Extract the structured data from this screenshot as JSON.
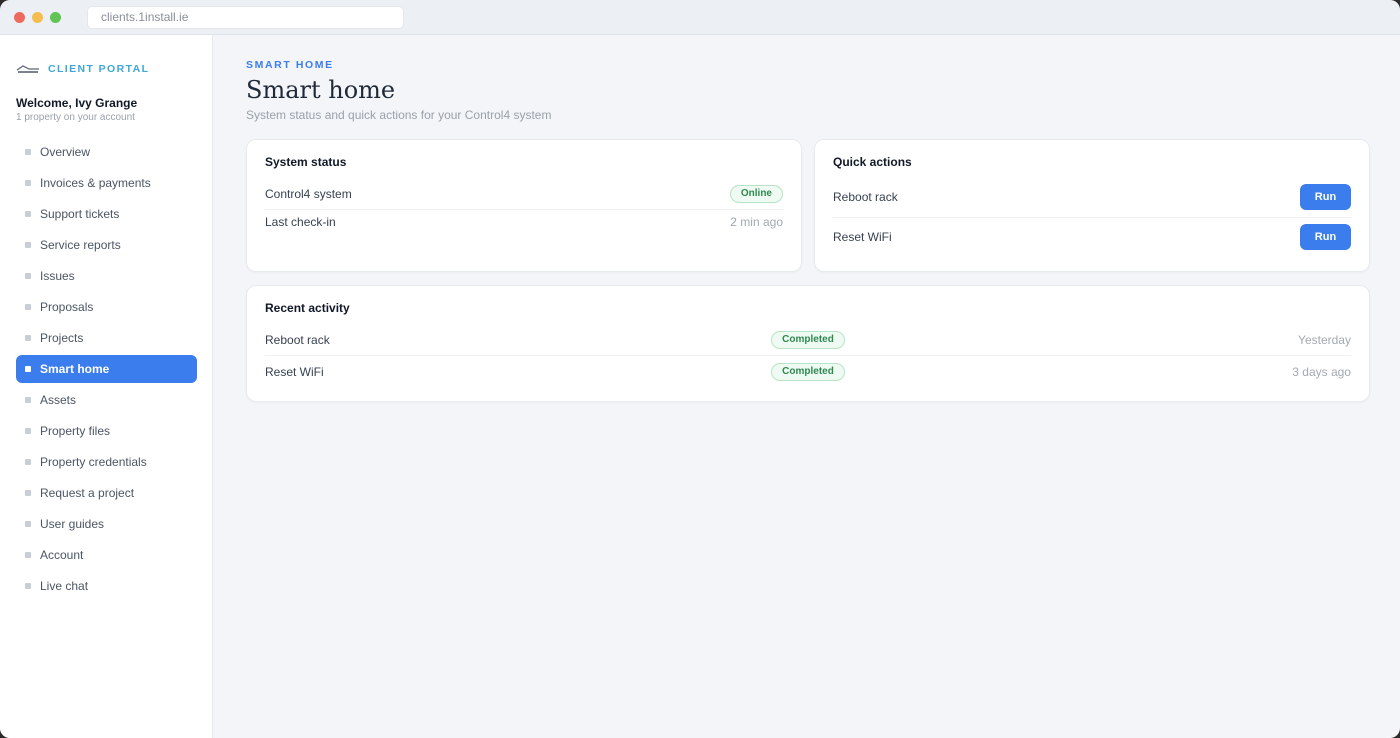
{
  "browser": {
    "url": "clients.1install.ie"
  },
  "sidebar": {
    "brand": "CLIENT PORTAL",
    "welcome": "Welcome, Ivy Grange",
    "welcome_sub": "1 property on your account",
    "items": [
      {
        "label": "Overview"
      },
      {
        "label": "Invoices & payments"
      },
      {
        "label": "Support tickets"
      },
      {
        "label": "Service reports"
      },
      {
        "label": "Issues"
      },
      {
        "label": "Proposals"
      },
      {
        "label": "Projects"
      },
      {
        "label": "Smart home",
        "active": true
      },
      {
        "label": "Assets"
      },
      {
        "label": "Property files"
      },
      {
        "label": "Property credentials"
      },
      {
        "label": "Request a project"
      },
      {
        "label": "User guides"
      },
      {
        "label": "Account"
      },
      {
        "label": "Live chat"
      }
    ]
  },
  "header": {
    "eyebrow": "SMART HOME",
    "title": "Smart home",
    "subtitle": "System status and quick actions for your Control4 system"
  },
  "system_status": {
    "title": "System status",
    "rows": [
      {
        "label": "Control4 system",
        "badge": "Online"
      },
      {
        "label": "Last check-in",
        "value": "2 min ago"
      }
    ]
  },
  "quick_actions": {
    "title": "Quick actions",
    "actions": [
      {
        "label": "Reboot rack",
        "button": "Run"
      },
      {
        "label": "Reset WiFi",
        "button": "Run"
      }
    ]
  },
  "recent_activity": {
    "title": "Recent activity",
    "rows": [
      {
        "label": "Reboot rack",
        "status": "Completed",
        "time": "Yesterday"
      },
      {
        "label": "Reset WiFi",
        "status": "Completed",
        "time": "3 days ago"
      }
    ]
  },
  "colors": {
    "accent": "#3b7ded",
    "brand": "#3fa7d6",
    "success_text": "#2f8a4f",
    "success_bg": "#eefaf2"
  }
}
